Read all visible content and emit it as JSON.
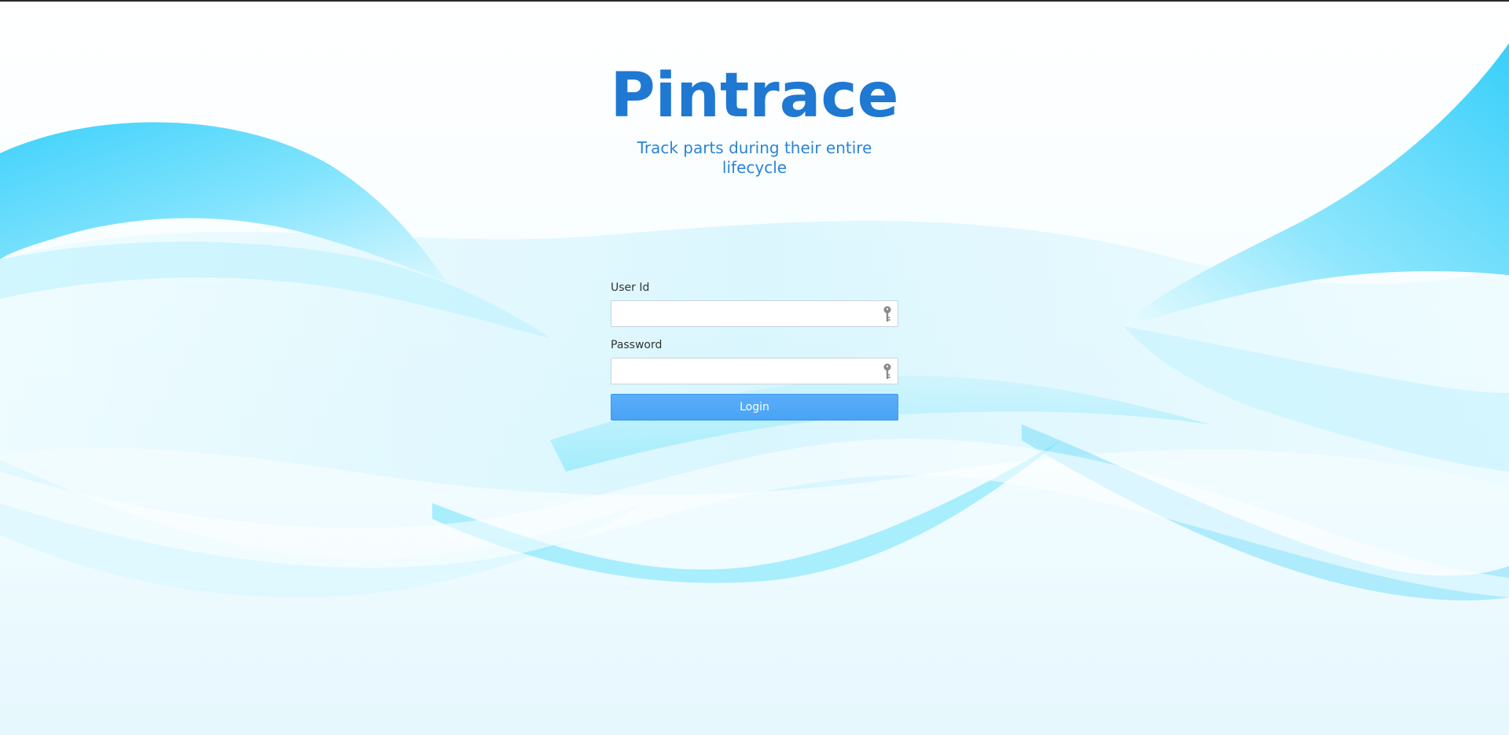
{
  "app": {
    "title": "Pintrace",
    "subtitle": "Track parts during their entire lifecycle"
  },
  "form": {
    "user_id": {
      "label": "User Id",
      "value": "",
      "placeholder": "",
      "icon": "key-icon"
    },
    "password": {
      "label": "Password",
      "value": "",
      "placeholder": "",
      "icon": "key-icon"
    },
    "login_label": "Login"
  },
  "colors": {
    "brand": "#1f78d1",
    "button": "#4aa3f5",
    "wave": "#45d4fb"
  }
}
